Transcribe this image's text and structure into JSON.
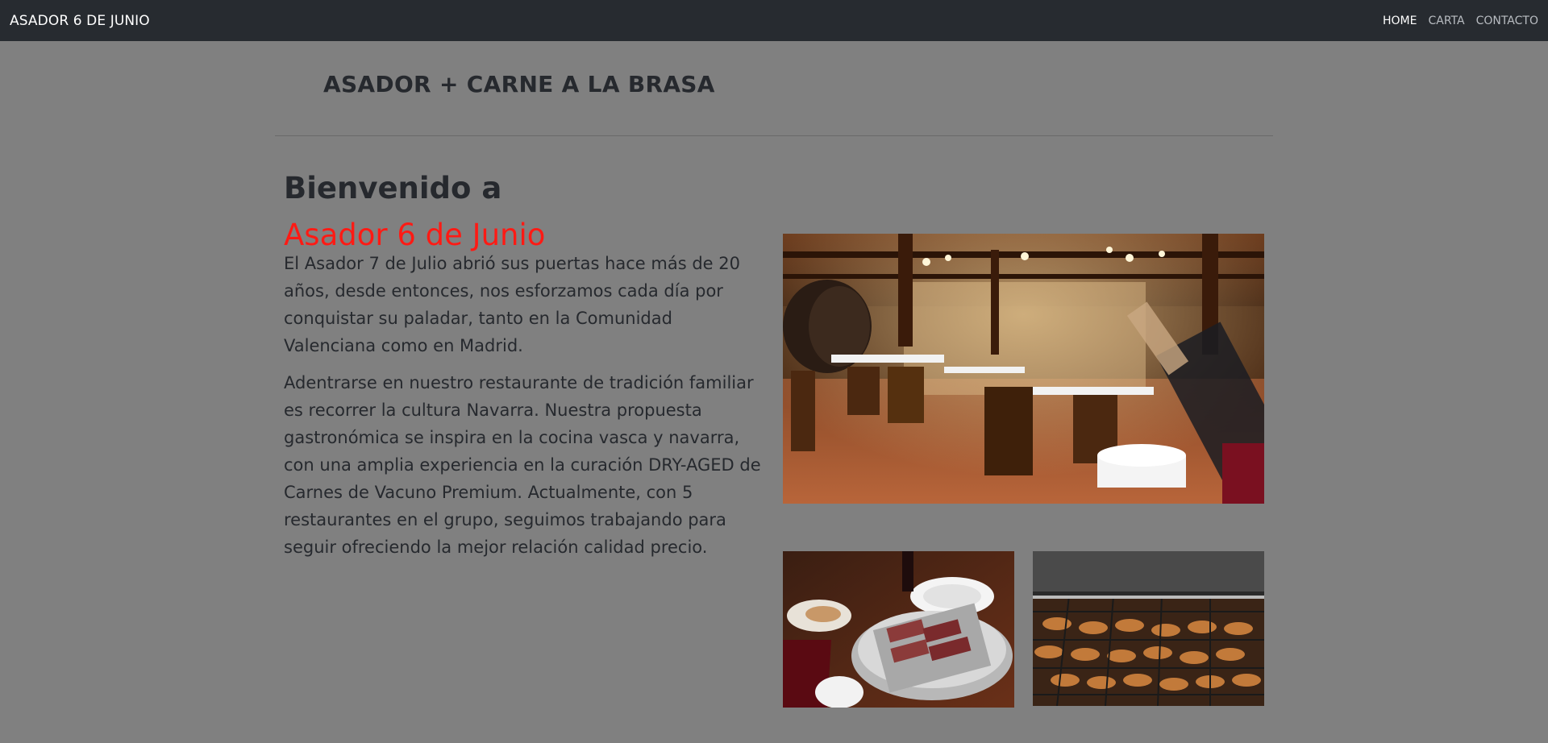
{
  "nav": {
    "brand": "ASADOR 6 DE JUNIO",
    "links": [
      {
        "label": "HOME",
        "active": true
      },
      {
        "label": "CARTA",
        "active": false
      },
      {
        "label": "CONTACTO",
        "active": false
      }
    ]
  },
  "hero": {
    "tagline": "ASADOR + CARNE A LA BRASA"
  },
  "intro": {
    "welcome": "Bienvenido a",
    "name": "Asador 6 de Junio",
    "paragraphs": [
      "El Asador 7 de Julio abrió sus puertas hace más de 20 años, desde entonces, nos esforzamos cada día por conquistar su paladar, tanto en la Comunidad Valenciana como en Madrid.",
      "Adentrarse en nuestro restaurante de tradición familiar es recorrer la cultura Navarra. Nuestra propuesta gastronómica se inspira en la cocina vasca y navarra, con una amplia experiencia en la curación DRY-AGED de Carnes de Vacuno Premium. Actualmente, con 5 restaurantes en el grupo, seguimos trabajando para seguir ofreciendo la mejor relación calidad precio."
    ]
  },
  "colors": {
    "navbar_bg": "#272b30",
    "page_bg": "#808080",
    "accent_red": "#ff1a14",
    "text_dark": "#26292e"
  }
}
